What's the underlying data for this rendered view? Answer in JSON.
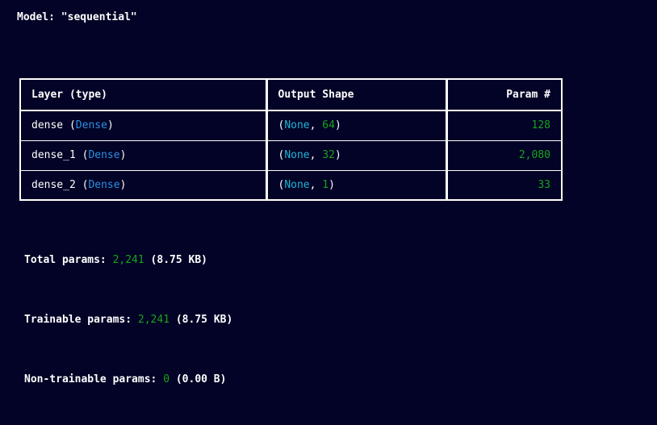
{
  "model": {
    "label": "Model: ",
    "name": "\"sequential\""
  },
  "table": {
    "headers": {
      "layer": "Layer (type)",
      "shape": "Output Shape",
      "params": "Param #"
    },
    "rows": [
      {
        "name": "dense",
        "type": "Dense",
        "shape_first": "None",
        "shape_second": "64",
        "params": "128"
      },
      {
        "name": "dense_1",
        "type": "Dense",
        "shape_first": "None",
        "shape_second": "32",
        "params": "2,080"
      },
      {
        "name": "dense_2",
        "type": "Dense",
        "shape_first": "None",
        "shape_second": "1",
        "params": "33"
      }
    ]
  },
  "stats": {
    "total": {
      "label": "Total params: ",
      "value": "2,241",
      "size": "(8.75 KB)"
    },
    "trainable": {
      "label": "Trainable params: ",
      "value": "2,241",
      "size": "(8.75 KB)"
    },
    "non_trainable": {
      "label": "Non-trainable params: ",
      "value": "0",
      "size": "(0.00 B)"
    }
  },
  "colors": {
    "background": "#020326",
    "text": "#ffffff",
    "type_blue": "#2f8fe6",
    "shape_cyan": "#1fb5d6",
    "number_green": "#18a31c"
  }
}
